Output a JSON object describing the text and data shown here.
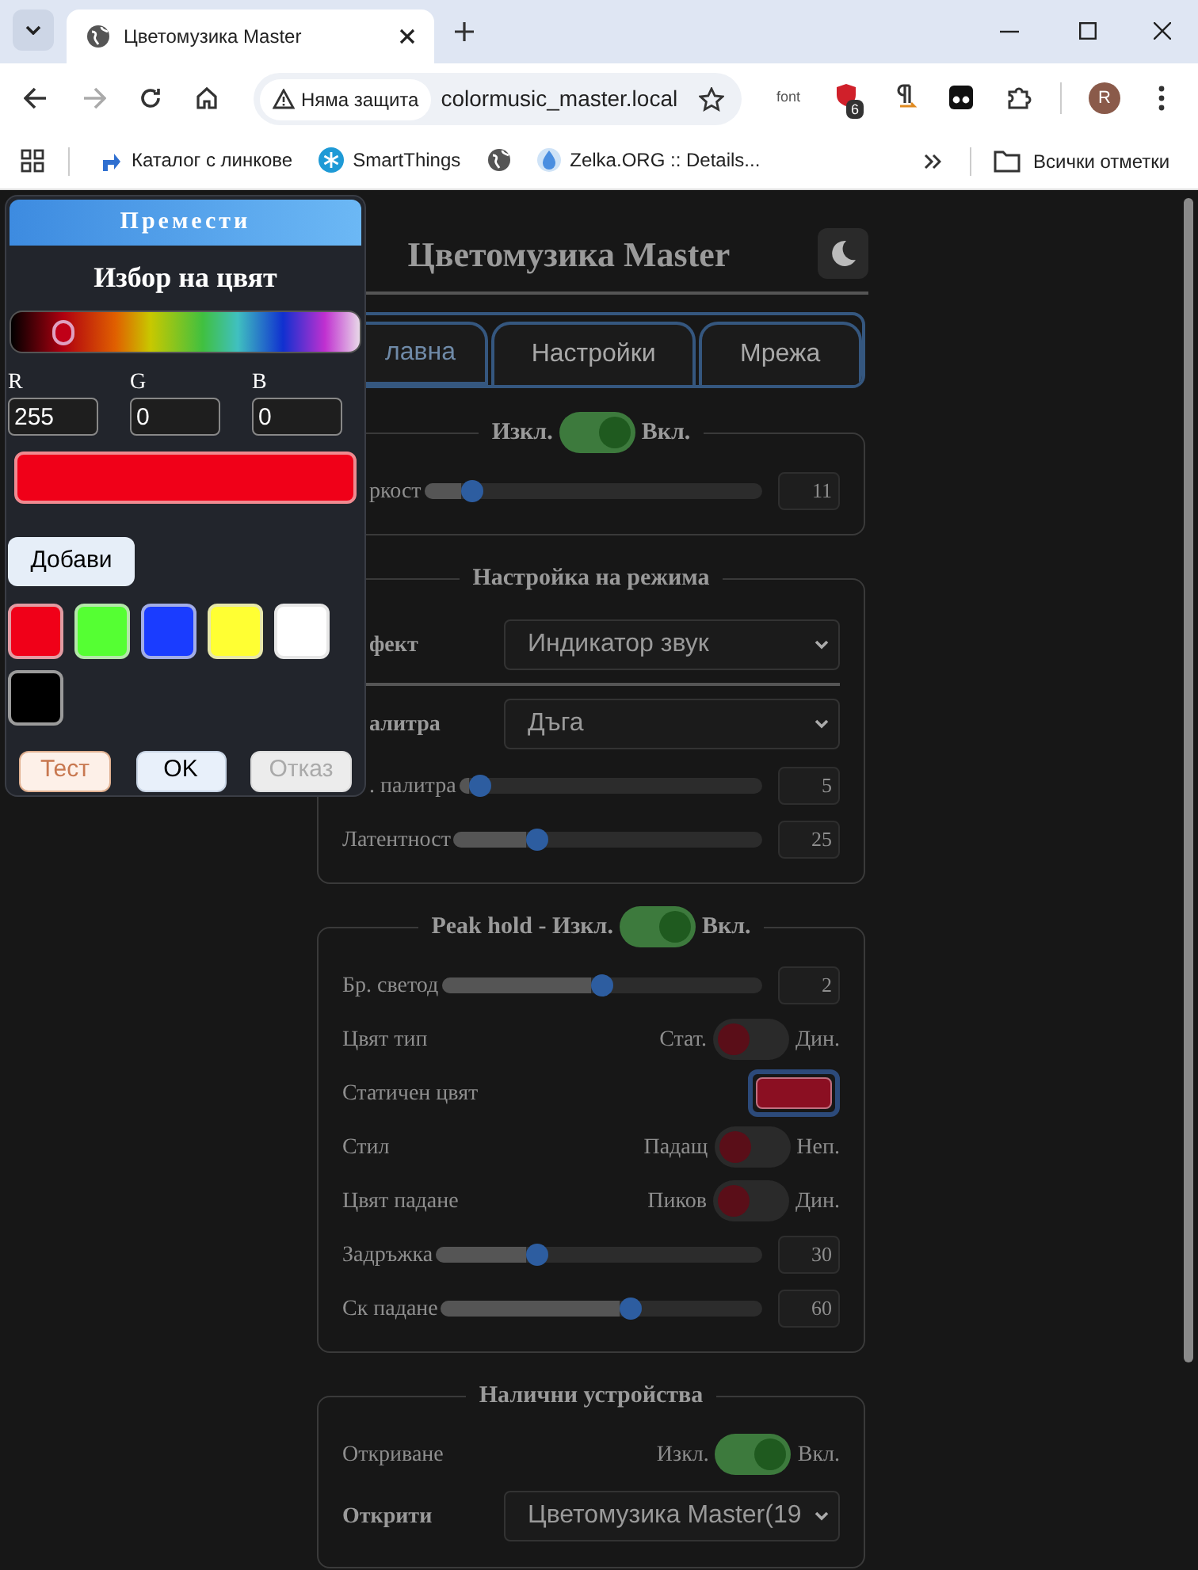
{
  "browser": {
    "tab_title": "Цветомузика Master",
    "security_label": "Няма защита",
    "url": "colormusic_master.local",
    "extension_label": "font",
    "extension_badge": "6",
    "profile_initial": "R",
    "bookmarks": [
      {
        "kind": "arrow",
        "label": "Каталог с линкове"
      },
      {
        "kind": "snowflake",
        "label": "SmartThings"
      },
      {
        "kind": "globe"
      },
      {
        "kind": "drop",
        "label": "Zelka.ORG :: Details..."
      }
    ],
    "all_bookmarks": "Всички отметки"
  },
  "app": {
    "title": "Цветомузика Master",
    "tabs": [
      {
        "label": "лавна",
        "selected": true
      },
      {
        "label": "Настройки",
        "selected": false
      },
      {
        "label": "Мрежа",
        "selected": false
      }
    ],
    "sections": [
      {
        "legend": {
          "kind": "switch",
          "text": "Изкл.",
          "on_label": "Вкл.",
          "checked": true
        },
        "rows": [
          {
            "kind": "slider",
            "label": "ркост",
            "cut": true,
            "level": 0.14,
            "value": "11"
          }
        ]
      },
      {
        "legend": {
          "kind": "title",
          "text": "Настройка на режима"
        },
        "rows": [
          {
            "kind": "select",
            "label": "фект",
            "cut": true,
            "value": "Индикатор звук",
            "divider": true
          },
          {
            "kind": "select",
            "label": "алитра",
            "cut": true,
            "value": "Дъга"
          },
          {
            "kind": "slider",
            "label": ". палитра",
            "cut": true,
            "level": 0.07,
            "value": "5"
          },
          {
            "kind": "slider",
            "label": "Латентност",
            "level": 0.27,
            "value": "25"
          }
        ]
      },
      {
        "legend": {
          "kind": "switch",
          "text": "Peak hold - Изкл.",
          "on_label": "Вкл.",
          "checked": true
        },
        "rows": [
          {
            "kind": "slider",
            "label": "Бр. светод",
            "level": 0.5,
            "value": "2"
          },
          {
            "kind": "switch",
            "label": "Цвят тип",
            "off_label": "Стат.",
            "on_label": "Дин.",
            "checked": false
          },
          {
            "kind": "color",
            "label": "Статичен цвят",
            "color": "#8b0f22"
          },
          {
            "kind": "switch",
            "label": "Стил",
            "off_label": "Падащ",
            "on_label": "Неп.",
            "checked": false
          },
          {
            "kind": "switch",
            "label": "Цвят падане",
            "off_label": "Пиков",
            "on_label": "Дин.",
            "checked": false
          },
          {
            "kind": "slider",
            "label": "Задръжка",
            "level": 0.31,
            "value": "30"
          },
          {
            "kind": "slider",
            "label": "Ск падане",
            "level": 0.59,
            "value": "60"
          }
        ]
      },
      {
        "legend": {
          "kind": "title",
          "text": "Налични устройства"
        },
        "rows": [
          {
            "kind": "switch",
            "label": "Откриване",
            "off_label": "Изкл.",
            "on_label": "Вкл.",
            "checked": true
          },
          {
            "kind": "select",
            "label": "Открити",
            "value": "Цветомузика Master(19"
          }
        ]
      }
    ]
  },
  "color_picker": {
    "handle": "Премести",
    "title": "Избор на цвят",
    "hue": {
      "level": 0.15
    },
    "channels": [
      {
        "label": "R",
        "value": "255"
      },
      {
        "label": "G",
        "value": "0"
      },
      {
        "label": "B",
        "value": "0"
      }
    ],
    "preview": {
      "color": "#f00018"
    },
    "add_button": "Добави",
    "swatches": [
      {
        "color": "#f00018"
      },
      {
        "color": "#55ff33"
      },
      {
        "color": "#1a3cff"
      },
      {
        "color": "#ffff33"
      },
      {
        "color": "#ffffff"
      },
      {
        "color": "#000000"
      }
    ],
    "buttons": [
      {
        "kind": "test",
        "label": "Тест"
      },
      {
        "kind": "ok",
        "label": "OK"
      },
      {
        "kind": "cancel",
        "label": "Отказ"
      }
    ]
  }
}
